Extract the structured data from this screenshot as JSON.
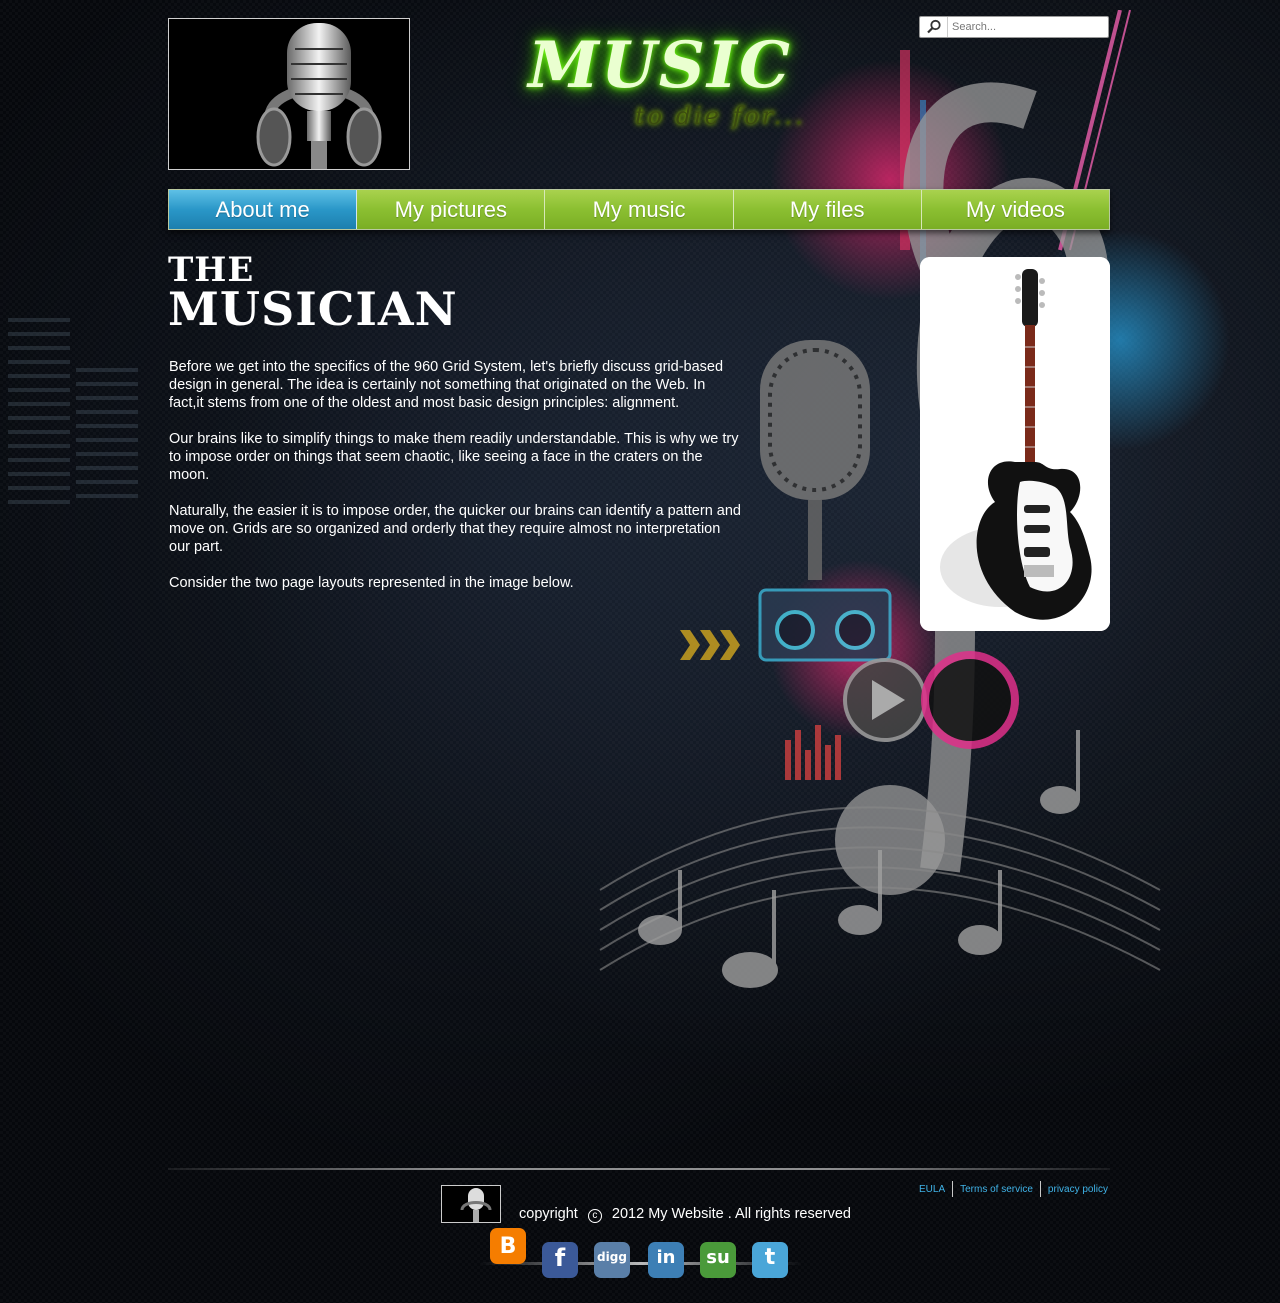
{
  "header": {
    "brand_title": "MUSIC",
    "brand_subtitle": "to die for...",
    "search_placeholder": "Search..."
  },
  "nav": {
    "items": [
      {
        "label": "About me",
        "active": true
      },
      {
        "label": "My pictures",
        "active": false
      },
      {
        "label": "My music",
        "active": false
      },
      {
        "label": "My files",
        "active": false
      },
      {
        "label": "My videos",
        "active": false
      }
    ]
  },
  "main": {
    "title_line1": "THE",
    "title_line2": "MUSICIAN",
    "paragraphs": [
      "Before we get into the specifics of the 960 Grid System, let's briefly discuss grid-based design in general. The idea is certainly not something that originated on the Web. In fact,it stems from one of the oldest and most basic design principles: alignment.",
      "Our brains like to simplify things to make them readily understandable. This is why we try to impose order on things that seem chaotic, like seeing a face in the craters on the moon.",
      "Naturally, the easier it is to impose order, the quicker our brains can identify a pattern and move on. Grids are so organized and orderly that they require almost no interpretation our part.",
      "Consider the two page layouts represented in the image below."
    ]
  },
  "footer": {
    "links": [
      "EULA",
      "Terms of service",
      "privacy policy"
    ],
    "copyright_prefix": "copyright",
    "copyright_symbol": "c",
    "copyright_text": "2012 My Website . All rights reserved",
    "social": [
      {
        "name": "blogger-icon",
        "glyph": "B",
        "color": "#f57d00"
      },
      {
        "name": "facebook-icon",
        "glyph": "f",
        "color": "#3b5998"
      },
      {
        "name": "digg-icon",
        "glyph": "digg",
        "color": "#5a7fa8"
      },
      {
        "name": "linkedin-icon",
        "glyph": "in",
        "color": "#3d7fb5"
      },
      {
        "name": "stumbleupon-icon",
        "glyph": "su",
        "color": "#4a9a3a"
      },
      {
        "name": "twitter-icon",
        "glyph": "t",
        "color": "#4aa6d8"
      }
    ]
  },
  "colors": {
    "nav_green": "#8bbf31",
    "nav_active_blue": "#2a97c8",
    "link_blue": "#3fb3e8",
    "brand_glow": "#7cff1a"
  }
}
